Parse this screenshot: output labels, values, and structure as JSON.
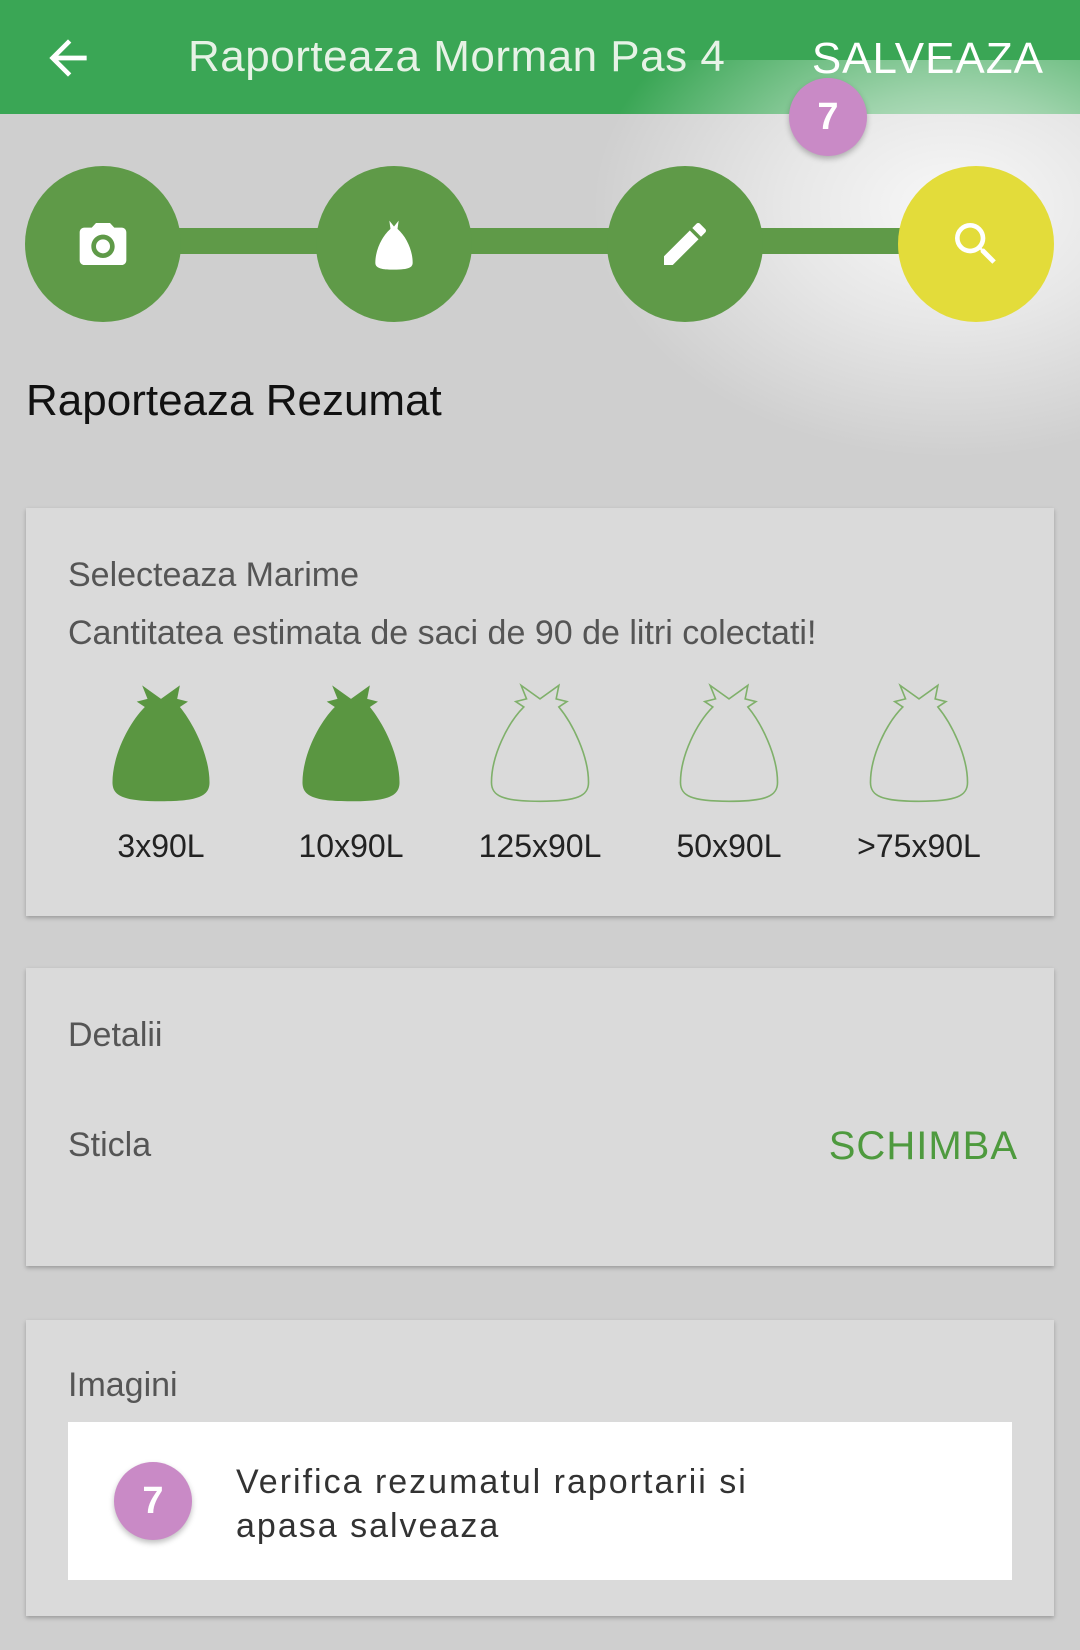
{
  "appbar": {
    "title": "Raporteaza Morman Pas 4",
    "save_label": "SALVEAZA",
    "back_icon": "arrow-left-icon"
  },
  "stepper": {
    "steps": [
      {
        "icon": "camera-icon",
        "active": false
      },
      {
        "icon": "bag-icon",
        "active": false
      },
      {
        "icon": "pencil-icon",
        "active": false
      },
      {
        "icon": "search-icon",
        "active": true
      }
    ]
  },
  "tutorial": {
    "step_number": "7",
    "message_line1": "Verifica rezumatul raportarii si",
    "message_line2": "apasa salveaza"
  },
  "summary": {
    "title": "Raporteaza Rezumat"
  },
  "size_card": {
    "heading": "Selecteaza Marime",
    "subtitle": "Cantitatea estimata de saci de 90 de litri colectati!",
    "options": [
      {
        "label": "3x90L",
        "selected": true
      },
      {
        "label": "10x90L",
        "selected": true
      },
      {
        "label": "125x90L",
        "selected": false
      },
      {
        "label": "50x90L",
        "selected": false
      },
      {
        "label": ">75x90L",
        "selected": false
      }
    ]
  },
  "details_card": {
    "heading": "Detalii",
    "value": "Sticla",
    "change_label": "SCHIMBA"
  },
  "images_card": {
    "heading": "Imagini"
  },
  "colors": {
    "appbar": "#3aa655",
    "step_done": "#5f9a48",
    "step_active": "#e3dc3a",
    "badge": "#c98ac6",
    "accent_text": "#4e9a3e"
  }
}
